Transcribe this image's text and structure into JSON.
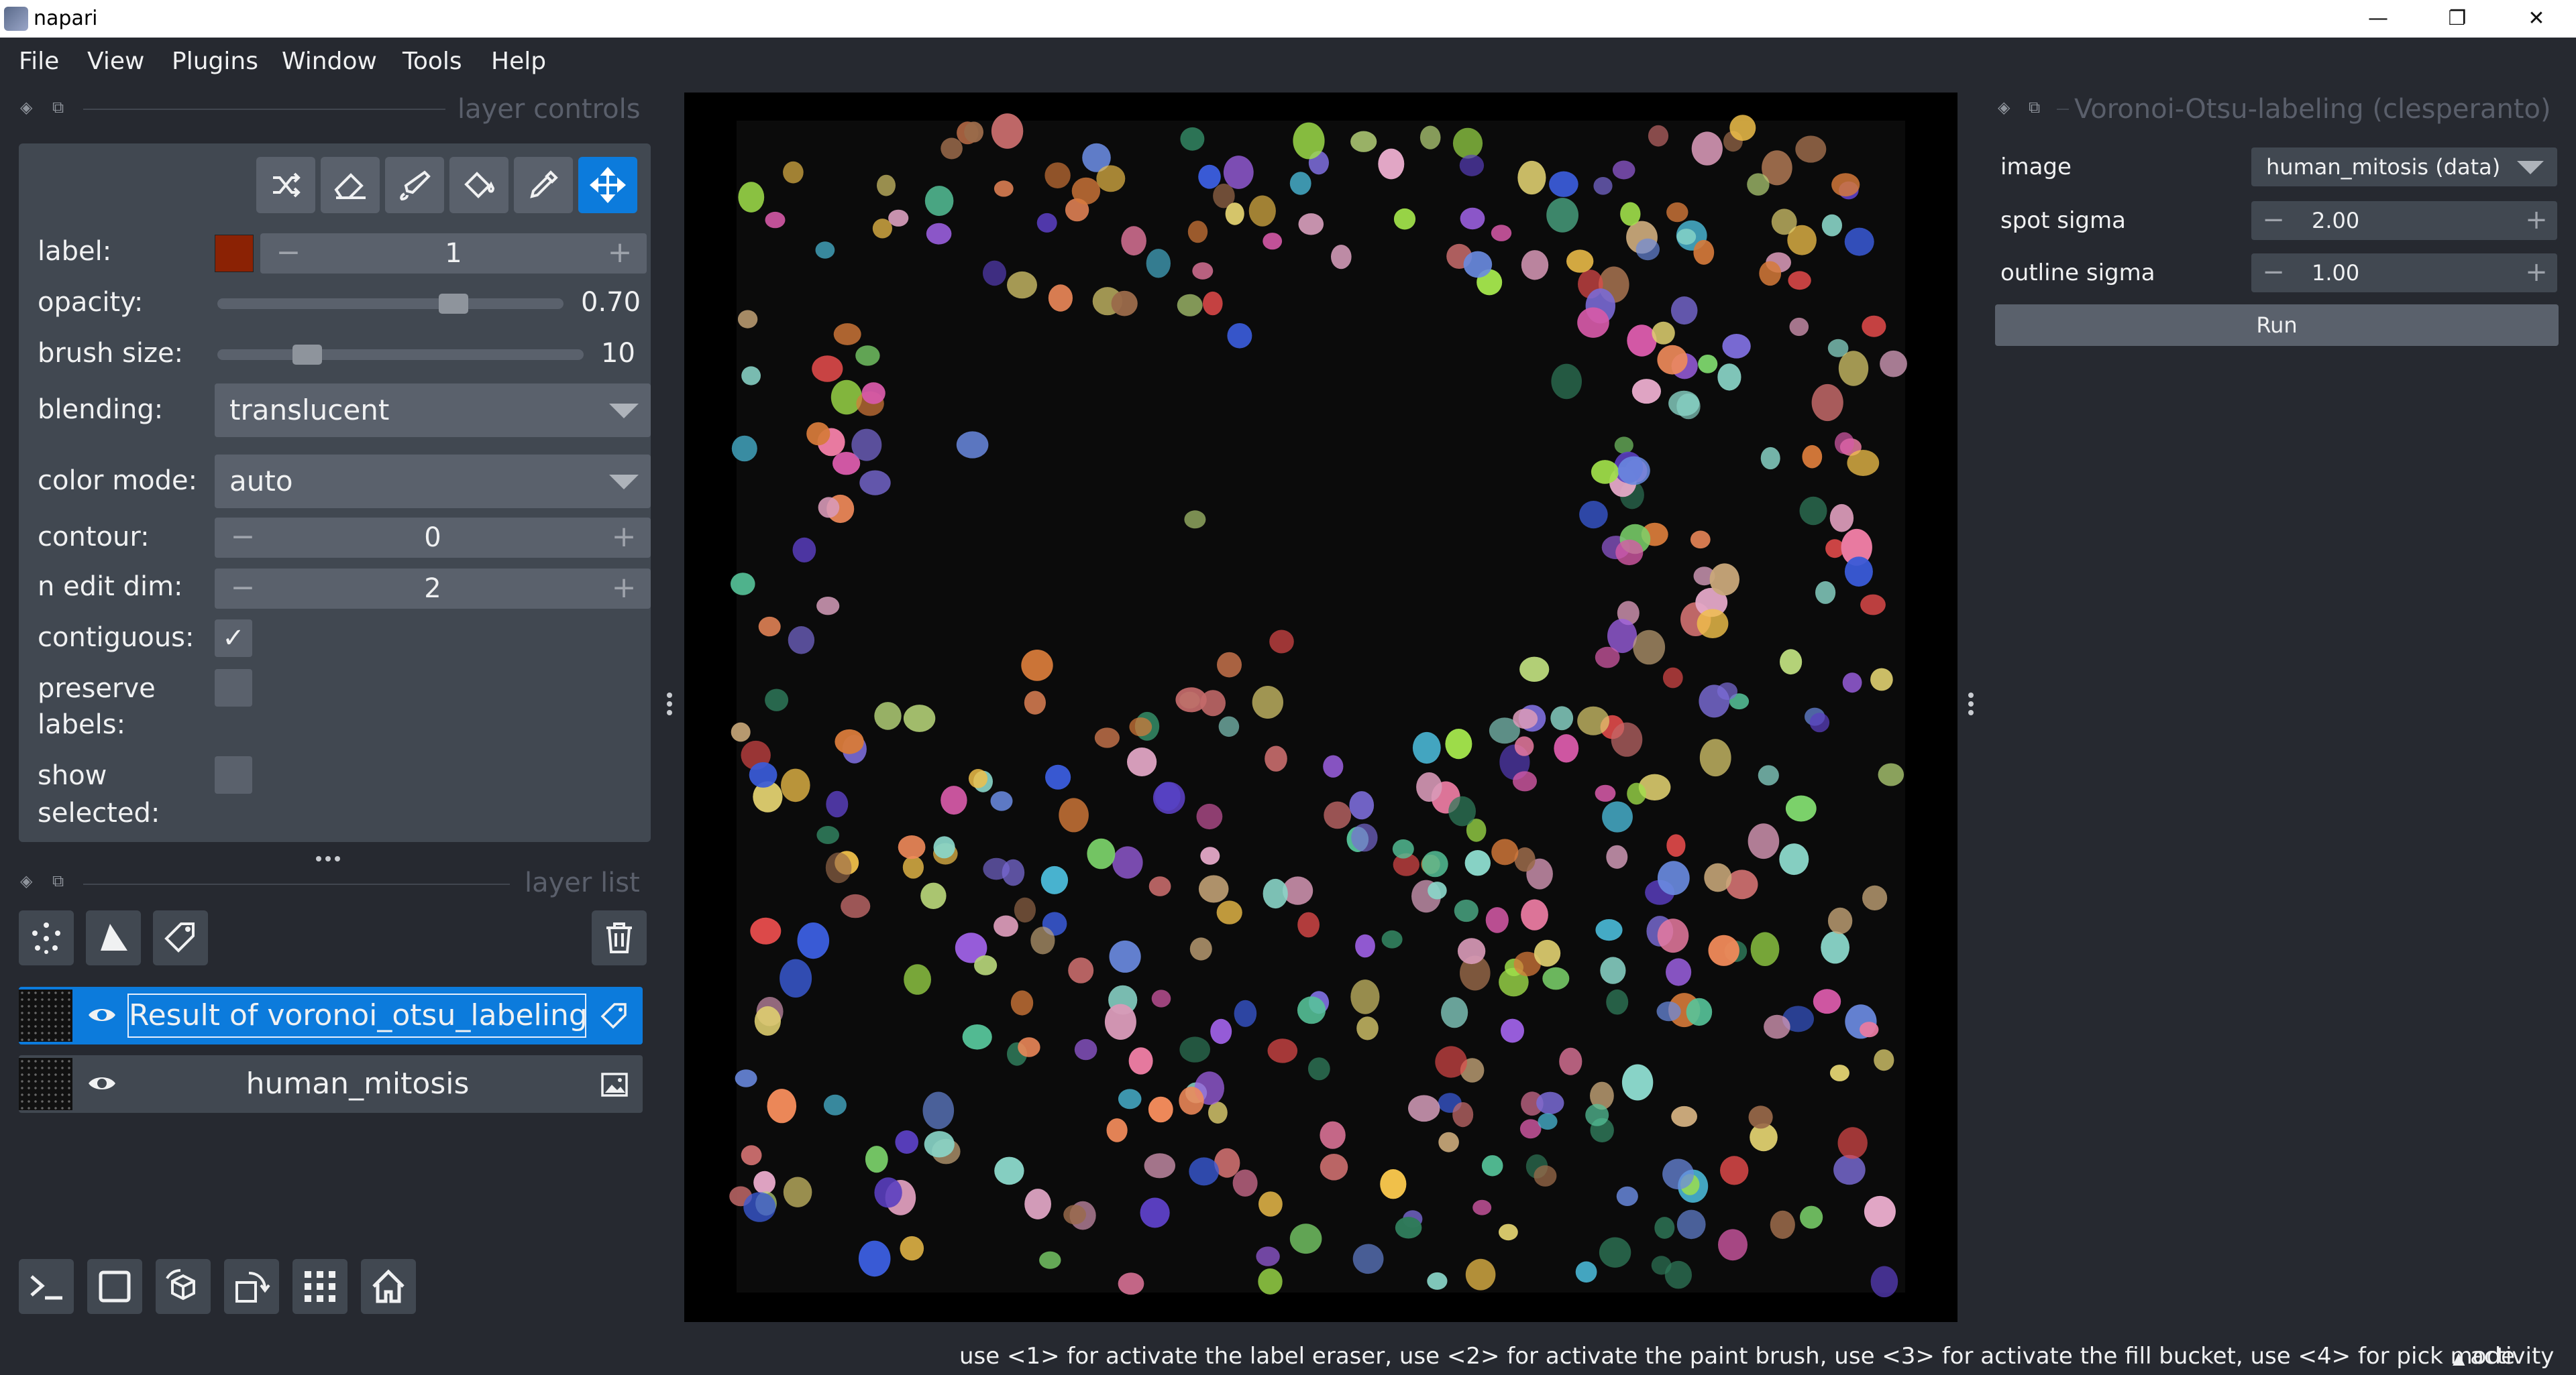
{
  "window": {
    "title": "napari",
    "controls": [
      "—",
      "❐",
      "✕"
    ]
  },
  "menu": [
    "File",
    "View",
    "Plugins",
    "Window",
    "Tools",
    "Help"
  ],
  "layer_controls": {
    "title": "layer controls",
    "label_label": "label:",
    "label_value": "1",
    "label_color": "#8b2204",
    "opacity_label": "opacity:",
    "opacity_value": "0.70",
    "opacity_fraction": 0.7,
    "brush_label": "brush size:",
    "brush_value": "10",
    "blending_label": "blending:",
    "blending_value": "translucent",
    "color_mode_label": "color mode:",
    "color_mode_value": "auto",
    "contour_label": "contour:",
    "contour_value": "0",
    "edit_dim_label": "n edit dim:",
    "edit_dim_value": "2",
    "contiguous_label": "contiguous:",
    "contiguous_mark": "✓",
    "preserve_label_1": "preserve",
    "preserve_label_2": "labels:",
    "show_label_1": "show",
    "show_label_2": "selected:"
  },
  "layer_list": {
    "title": "layer list",
    "layers": [
      {
        "name": "Result of voronoi_otsu_labeling",
        "type": "labels",
        "selected": true
      },
      {
        "name": "human_mitosis",
        "type": "image",
        "selected": false
      }
    ]
  },
  "plugin_panel": {
    "title": "Voronoi-Otsu-labeling (clesperanto)",
    "image_label": "image",
    "image_value": "human_mitosis (data)",
    "spot_label": "spot sigma",
    "spot_value": "2.00",
    "outline_label": "outline sigma",
    "outline_value": "1.00",
    "run_label": "Run"
  },
  "status": {
    "message": "use <1> for activate the label eraser, use <2> for activate the paint brush, use <3> for activate the fill bucket, use <4> for pick mode",
    "activity": "activity"
  },
  "colors": {
    "bg": "#262930",
    "panel": "#414851",
    "control": "#5a616c",
    "accent": "#0c7bdc"
  }
}
